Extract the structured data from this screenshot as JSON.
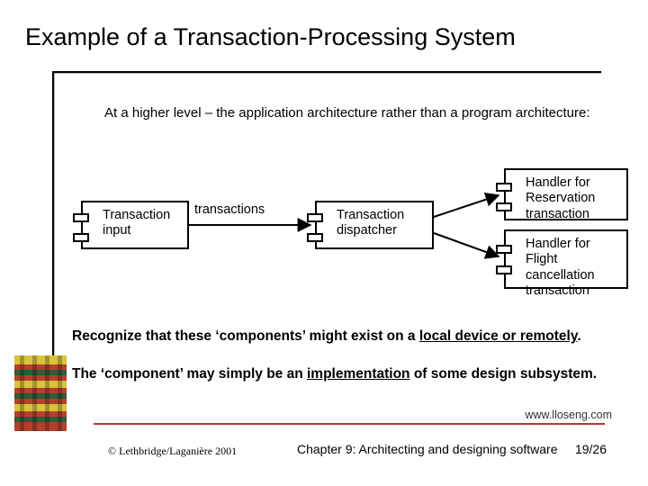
{
  "title": "Example of a Transaction-Processing System",
  "subtitle": "At a higher level – the application architecture rather than a program architecture:",
  "diagram": {
    "input": "Transaction\ninput",
    "dispatcher": "Transaction\ndispatcher",
    "reservation": "Handler for\nReservation\ntransaction",
    "cancellation": "Handler for\nFlight cancellation\ntransaction",
    "arrow_label": "transactions"
  },
  "para1_a": "Recognize that these ‘components’ might exist on a ",
  "para1_u": "local device or remotely",
  "para1_b": ".",
  "para2_a": "The ‘component’ may simply be an ",
  "para2_u": "implementation",
  "para2_b": " of some design subsystem.",
  "url": "www.lloseng.com",
  "copyright": "© Lethbridge/Laganière 2001",
  "chapter": "Chapter 9: Architecting and designing software",
  "pagenum": "19/26"
}
